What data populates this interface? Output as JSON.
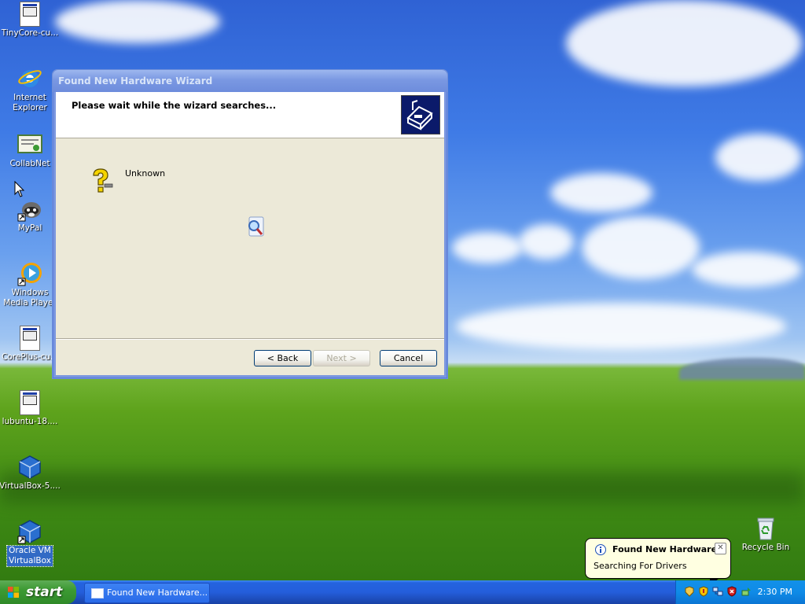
{
  "desktop": {
    "icons": [
      {
        "label": "TinyCore-cu..."
      },
      {
        "label": "Internet Explorer"
      },
      {
        "label": "CollabNet"
      },
      {
        "label": "MyPal"
      },
      {
        "label": "Windows Media Player"
      },
      {
        "label": "CorePlus-cu..."
      },
      {
        "label": "lubuntu-18...."
      },
      {
        "label": "VirtualBox-5...."
      },
      {
        "label": "Oracle VM VirtualBox"
      },
      {
        "label": "Recycle Bin"
      }
    ]
  },
  "window": {
    "title": "Found New Hardware Wizard",
    "header_text": "Please wait while the wizard searches...",
    "device_label": "Unknown",
    "buttons": {
      "back": "< Back",
      "next": "Next >",
      "cancel": "Cancel"
    }
  },
  "taskbar": {
    "start_label": "start",
    "task_button": "Found New Hardware...",
    "clock": "2:30 PM"
  },
  "balloon": {
    "title": "Found New Hardware",
    "text": "Searching For Drivers",
    "close": "✕"
  },
  "colors": {
    "title_inactive": "#7a96df",
    "taskbar": "#245edb",
    "start_green": "#3c9a33",
    "tray": "#0f8be7"
  }
}
